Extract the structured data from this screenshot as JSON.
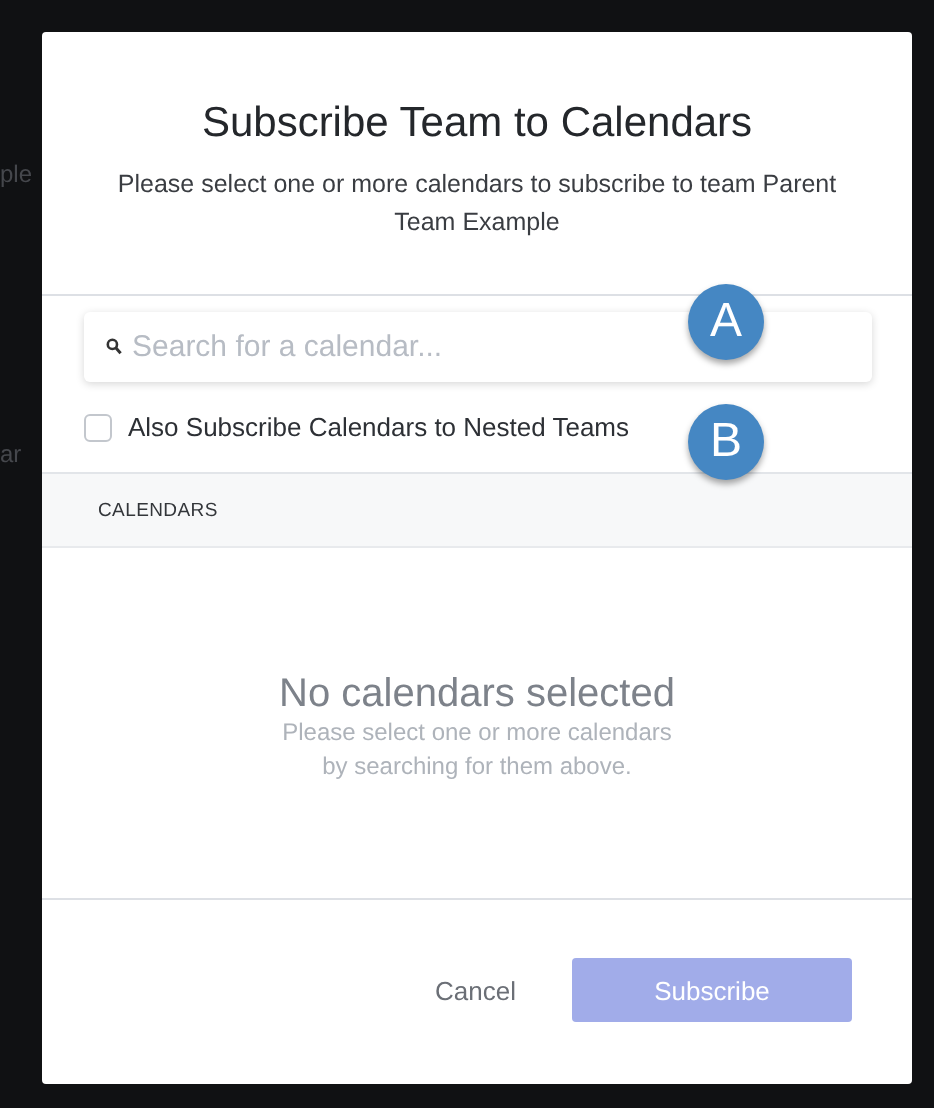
{
  "background_page": {
    "fragments": [
      "ple",
      "ar"
    ]
  },
  "dialog": {
    "title": "Subscribe Team to Calendars",
    "subtitle": "Please select one or more calendars to subscribe to team Parent Team Example",
    "search": {
      "placeholder": "Search for a calendar..."
    },
    "nested_option": {
      "label": "Also Subscribe Calendars to Nested Teams",
      "checked": false
    },
    "section_header": "CALENDARS",
    "empty_state": {
      "title": "No calendars selected",
      "message": "Please select one or more calendars by searching for them above."
    },
    "buttons": [
      {
        "label": "Cancel",
        "kind": "link",
        "disabled": false
      },
      {
        "label": "Subscribe",
        "kind": "primary",
        "disabled": true
      }
    ]
  },
  "callouts": [
    {
      "label": "A"
    },
    {
      "label": "B"
    }
  ]
}
